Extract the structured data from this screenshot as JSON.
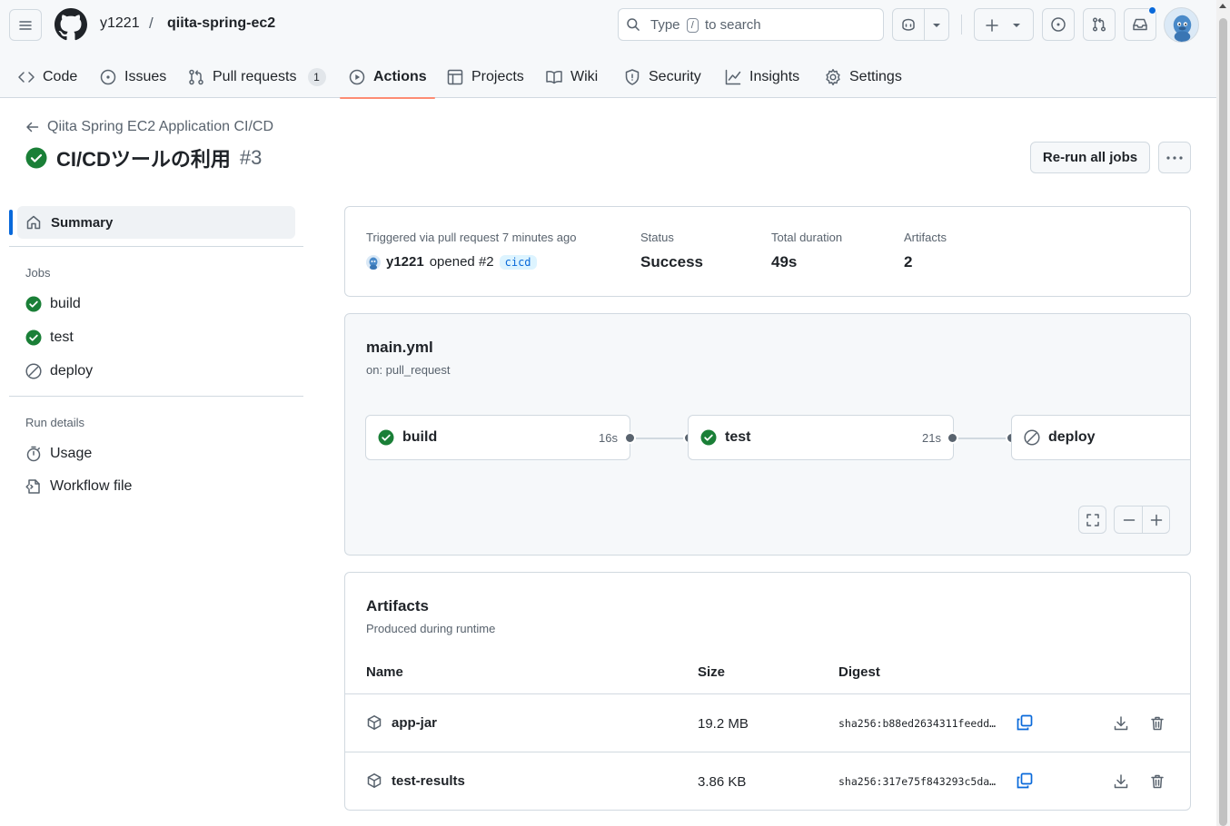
{
  "header": {
    "owner": "y1221",
    "separator": "/",
    "repo": "qiita-spring-ec2",
    "search": {
      "prefix": "Type",
      "key": "/",
      "suffix": "to search"
    }
  },
  "tabs": [
    {
      "label": "Code",
      "icon": "code-icon"
    },
    {
      "label": "Issues",
      "icon": "issue-icon"
    },
    {
      "label": "Pull requests",
      "icon": "pull-request-icon",
      "count": "1"
    },
    {
      "label": "Actions",
      "icon": "play-icon",
      "active": true
    },
    {
      "label": "Projects",
      "icon": "table-icon"
    },
    {
      "label": "Wiki",
      "icon": "book-icon"
    },
    {
      "label": "Security",
      "icon": "shield-icon"
    },
    {
      "label": "Insights",
      "icon": "graph-icon"
    },
    {
      "label": "Settings",
      "icon": "gear-icon"
    }
  ],
  "run": {
    "workflow_name": "Qiita Spring EC2 Application CI/CD",
    "title": "CI/CDツールの利用",
    "number": "#3",
    "rerun_label": "Re-run all jobs"
  },
  "sidebar": {
    "summary_label": "Summary",
    "jobs_heading": "Jobs",
    "jobs": [
      {
        "label": "build",
        "status": "success"
      },
      {
        "label": "test",
        "status": "success"
      },
      {
        "label": "deploy",
        "status": "skipped"
      }
    ],
    "details_heading": "Run details",
    "details": [
      {
        "label": "Usage",
        "icon": "stopwatch-icon"
      },
      {
        "label": "Workflow file",
        "icon": "file-code-icon"
      }
    ]
  },
  "summary": {
    "trigger_label": "Triggered via pull request 7 minutes ago",
    "actor": "y1221",
    "action": "opened #2",
    "branch": "cicd",
    "status_label": "Status",
    "status_value": "Success",
    "duration_label": "Total duration",
    "duration_value": "49s",
    "artifacts_label": "Artifacts",
    "artifacts_value": "2"
  },
  "workflow": {
    "file": "main.yml",
    "trigger": "on: pull_request",
    "jobs": [
      {
        "name": "build",
        "duration": "16s",
        "status": "success"
      },
      {
        "name": "test",
        "duration": "21s",
        "status": "success"
      },
      {
        "name": "deploy",
        "duration": "",
        "status": "skipped"
      }
    ]
  },
  "artifacts": {
    "title": "Artifacts",
    "subtitle": "Produced during runtime",
    "columns": {
      "name": "Name",
      "size": "Size",
      "digest": "Digest"
    },
    "rows": [
      {
        "name": "app-jar",
        "size": "19.2 MB",
        "digest": "sha256:b88ed2634311feedd…"
      },
      {
        "name": "test-results",
        "size": "3.86 KB",
        "digest": "sha256:317e75f843293c5da…"
      }
    ]
  },
  "colors": {
    "success": "#1a7f37",
    "accent": "#0969da",
    "tab_underline": "#fd8c73",
    "border": "#d1d9e0"
  }
}
